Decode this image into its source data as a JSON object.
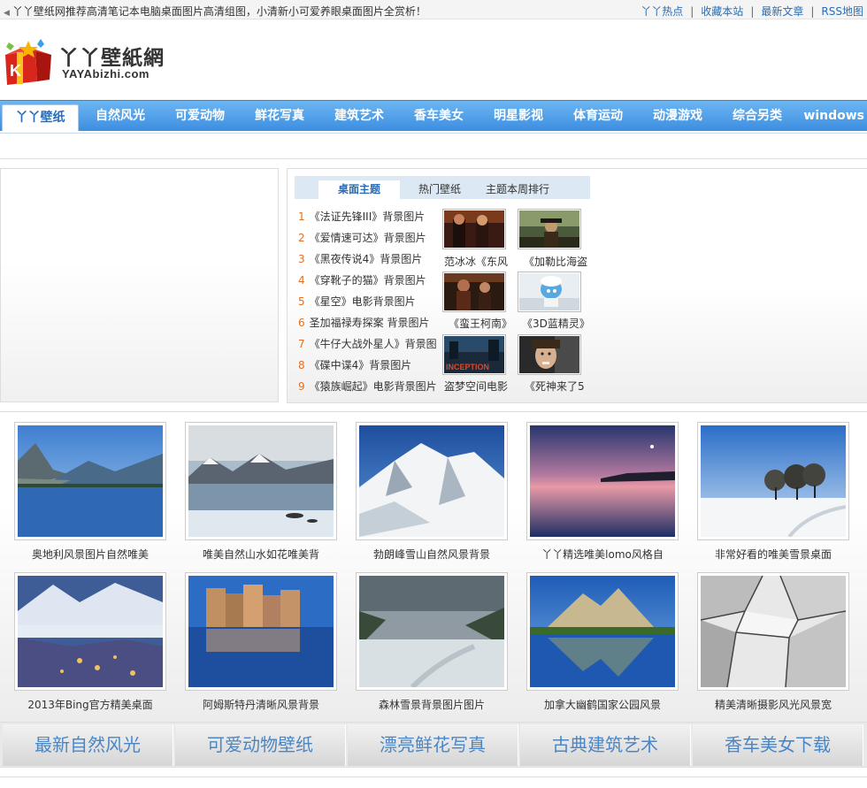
{
  "topbar": {
    "notice": "丫丫壁纸网推荐高清笔记本电脑桌面图片高清组图，小清新小可爱养眼桌面图片全赏析！",
    "links": [
      "丫丫热点",
      "收藏本站",
      "最新文章",
      "RSS地图"
    ]
  },
  "logo": {
    "name_cn": "丫丫壁紙網",
    "name_en": "YAYAbizhi.com"
  },
  "nav": {
    "items": [
      "丫丫壁纸",
      "自然风光",
      "可爱动物",
      "鲜花写真",
      "建筑艺术",
      "香车美女",
      "明星影视",
      "体育运动",
      "动漫游戏",
      "综合另类",
      "windows"
    ],
    "active": 0
  },
  "featured": {
    "tabs": [
      "桌面主题",
      "热门壁纸",
      "主题本周排行"
    ],
    "active_tab": 0,
    "ranking": [
      {
        "num": "1",
        "title": "《法证先锋III》背景图片"
      },
      {
        "num": "2",
        "title": "《爱情速可达》背景图片"
      },
      {
        "num": "3",
        "title": "《黑夜传说4》背景图片"
      },
      {
        "num": "4",
        "title": "《穿靴子的猫》背景图片"
      },
      {
        "num": "5",
        "title": "《星空》电影背景图片"
      },
      {
        "num": "6",
        "title": "圣加福禄寿探案 背景图片"
      },
      {
        "num": "7",
        "title": "《牛仔大战外星人》背景图"
      },
      {
        "num": "8",
        "title": "《碟中谍4》背景图片"
      },
      {
        "num": "9",
        "title": "《猿族崛起》电影背景图片"
      }
    ],
    "thumbs": [
      {
        "caption": "范冰冰《东风"
      },
      {
        "caption": "《加勒比海盗"
      },
      {
        "caption": "《蛮王柯南》"
      },
      {
        "caption": "《3D蓝精灵》"
      },
      {
        "caption": "盗梦空间电影"
      },
      {
        "caption": "《死神来了5"
      }
    ],
    "thumb_text": "INCEPTION"
  },
  "gallery": {
    "items": [
      {
        "caption": "奥地利风景图片自然唯美"
      },
      {
        "caption": "唯美自然山水如花唯美背"
      },
      {
        "caption": "勃朗峰雪山自然风景背景"
      },
      {
        "caption": "丫丫精选唯美lomo风格自"
      },
      {
        "caption": "非常好看的唯美雪景桌面"
      },
      {
        "caption": "2013年Bing官方精美桌面"
      },
      {
        "caption": "阿姆斯特丹清晰风景背景"
      },
      {
        "caption": "森林雪景背景图片图片"
      },
      {
        "caption": "加拿大幽鹤国家公园风景"
      },
      {
        "caption": "精美清晰摄影风光风景宽"
      }
    ]
  },
  "categories": [
    "最新自然风光",
    "可爱动物壁纸",
    "漂亮鲜花写真",
    "古典建筑艺术",
    "香车美女下载"
  ]
}
